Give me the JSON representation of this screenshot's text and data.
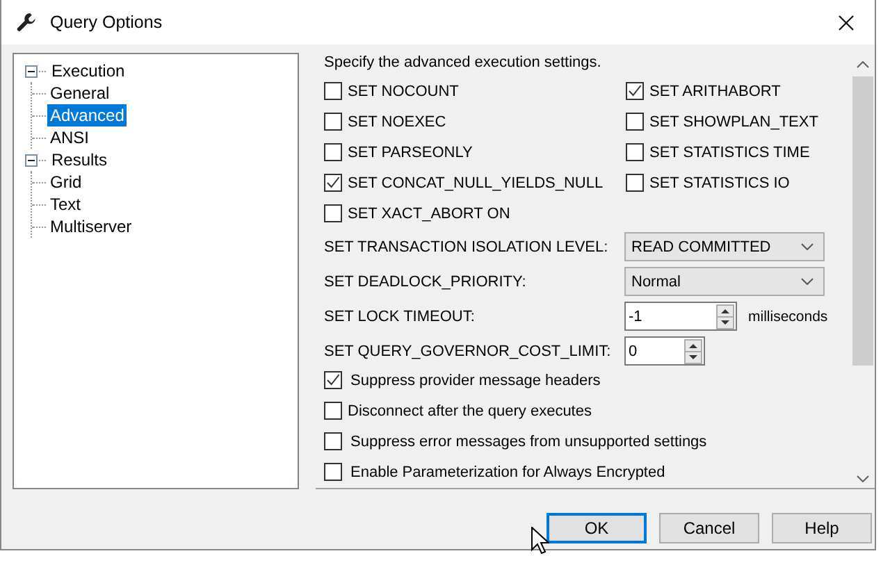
{
  "window": {
    "title": "Query Options"
  },
  "tree": [
    {
      "label": "Execution",
      "expanded": true,
      "selected": false,
      "children": [
        {
          "label": "General",
          "selected": false
        },
        {
          "label": "Advanced",
          "selected": true
        },
        {
          "label": "ANSI",
          "selected": false
        }
      ]
    },
    {
      "label": "Results",
      "expanded": true,
      "selected": false,
      "children": [
        {
          "label": "Grid",
          "selected": false
        },
        {
          "label": "Text",
          "selected": false
        },
        {
          "label": "Multiserver",
          "selected": false
        }
      ]
    }
  ],
  "description": "Specify the advanced execution settings.",
  "options": [
    {
      "label": "SET NOCOUNT",
      "checked": false
    },
    {
      "label": "SET ARITHABORT",
      "checked": true
    },
    {
      "label": "SET NOEXEC",
      "checked": false
    },
    {
      "label": "SET SHOWPLAN_TEXT",
      "checked": false
    },
    {
      "label": "SET PARSEONLY",
      "checked": false
    },
    {
      "label": "SET STATISTICS TIME",
      "checked": false
    },
    {
      "label": "SET CONCAT_NULL_YIELDS_NULL",
      "checked": true
    },
    {
      "label": "SET STATISTICS IO",
      "checked": false
    },
    {
      "label": "SET XACT_ABORT ON",
      "checked": false
    }
  ],
  "settings": [
    {
      "kind": "dropdown",
      "label": "SET TRANSACTION ISOLATION LEVEL:",
      "value": "READ COMMITTED"
    },
    {
      "kind": "dropdown",
      "label": "SET DEADLOCK_PRIORITY:",
      "value": "Normal"
    },
    {
      "kind": "spinner",
      "label": "SET LOCK TIMEOUT:",
      "value": "-1",
      "unit": "milliseconds"
    },
    {
      "kind": "spinner",
      "label": "SET QUERY_GOVERNOR_COST_LIMIT:",
      "value": "0"
    }
  ],
  "more_options": [
    {
      "label": "Suppress provider message headers",
      "checked": true
    },
    {
      "label": "Disconnect after the query executes",
      "checked": false
    },
    {
      "label": "Suppress error messages from unsupported settings",
      "checked": false
    },
    {
      "label": "Enable Parameterization for Always Encrypted",
      "checked": false
    }
  ],
  "buttons": [
    {
      "label": "OK",
      "default": true
    },
    {
      "label": "Cancel",
      "default": false
    },
    {
      "label": "Help",
      "default": false
    }
  ]
}
